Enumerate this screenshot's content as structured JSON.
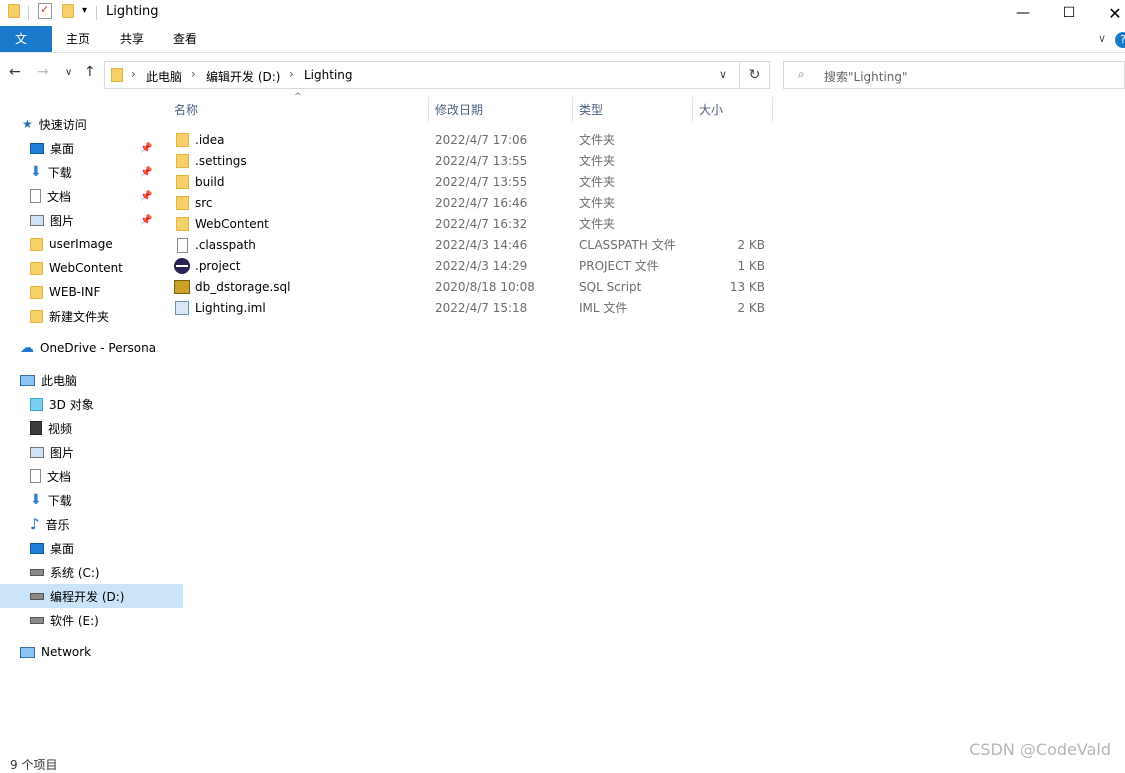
{
  "window": {
    "title": "Lighting",
    "minimize_icon": "minimize",
    "maximize_icon": "maximize",
    "close_icon": "close"
  },
  "ribbon": {
    "tabs": [
      "文件",
      "主页",
      "共享",
      "查看"
    ]
  },
  "address": {
    "path": [
      "此电脑",
      "编辑开发 (D:)",
      "Lighting"
    ],
    "search_placeholder": "搜索\"Lighting\""
  },
  "sidebar": {
    "quick_access": "快速访问",
    "items": [
      {
        "label": "快速访问",
        "icon": "star-icon"
      },
      {
        "label": "桌面",
        "icon": "desktop-icon",
        "pinned": true
      },
      {
        "label": "下载",
        "icon": "download-icon",
        "pinned": true
      },
      {
        "label": "文档",
        "icon": "document-icon",
        "pinned": true
      },
      {
        "label": "图片",
        "icon": "pictures-icon",
        "pinned": true
      },
      {
        "label": "userImage",
        "icon": "folder-icon"
      },
      {
        "label": "WebContent",
        "icon": "folder-icon"
      },
      {
        "label": "WEB-INF",
        "icon": "folder-icon"
      },
      {
        "label": "新建文件夹",
        "icon": "folder-icon"
      },
      {
        "label": "OneDrive - Persona",
        "icon": "cloud-icon"
      },
      {
        "label": "此电脑",
        "icon": "computer-icon"
      },
      {
        "label": "3D 对象",
        "icon": "cube-icon"
      },
      {
        "label": "视频",
        "icon": "video-icon"
      },
      {
        "label": "图片",
        "icon": "pictures-icon"
      },
      {
        "label": "文档",
        "icon": "document-icon"
      },
      {
        "label": "下载",
        "icon": "download-icon"
      },
      {
        "label": "音乐",
        "icon": "music-icon"
      },
      {
        "label": "桌面",
        "icon": "desktop-icon"
      },
      {
        "label": "系统 (C:)",
        "icon": "drive-icon"
      },
      {
        "label": "编程开发 (D:)",
        "icon": "drive-icon",
        "selected": true
      },
      {
        "label": "软件 (E:)",
        "icon": "drive-icon"
      },
      {
        "label": "Network",
        "icon": "network-icon"
      }
    ]
  },
  "columns": [
    "名称",
    "修改日期",
    "类型",
    "大小"
  ],
  "files": [
    {
      "name": ".idea",
      "date": "2022/4/7 17:06",
      "type": "文件夹",
      "size": "",
      "icon": "folder-icon"
    },
    {
      "name": ".settings",
      "date": "2022/4/7 13:55",
      "type": "文件夹",
      "size": "",
      "icon": "folder-icon"
    },
    {
      "name": "build",
      "date": "2022/4/7 13:55",
      "type": "文件夹",
      "size": "",
      "icon": "folder-icon"
    },
    {
      "name": "src",
      "date": "2022/4/7 16:46",
      "type": "文件夹",
      "size": "",
      "icon": "folder-icon"
    },
    {
      "name": "WebContent",
      "date": "2022/4/7 16:32",
      "type": "文件夹",
      "size": "",
      "icon": "folder-icon"
    },
    {
      "name": ".classpath",
      "date": "2022/4/3 14:46",
      "type": "CLASSPATH 文件",
      "size": "2 KB",
      "icon": "file-icon"
    },
    {
      "name": ".project",
      "date": "2022/4/3 14:29",
      "type": "PROJECT 文件",
      "size": "1 KB",
      "icon": "eclipse-icon"
    },
    {
      "name": "db_dstorage.sql",
      "date": "2020/8/18 10:08",
      "type": "SQL Script",
      "size": "13 KB",
      "icon": "sql-icon"
    },
    {
      "name": "Lighting.iml",
      "date": "2022/4/7 15:18",
      "type": "IML 文件",
      "size": "2 KB",
      "icon": "iml-icon"
    }
  ],
  "status": "9 个项目",
  "watermark": "CSDN @CodeVald"
}
